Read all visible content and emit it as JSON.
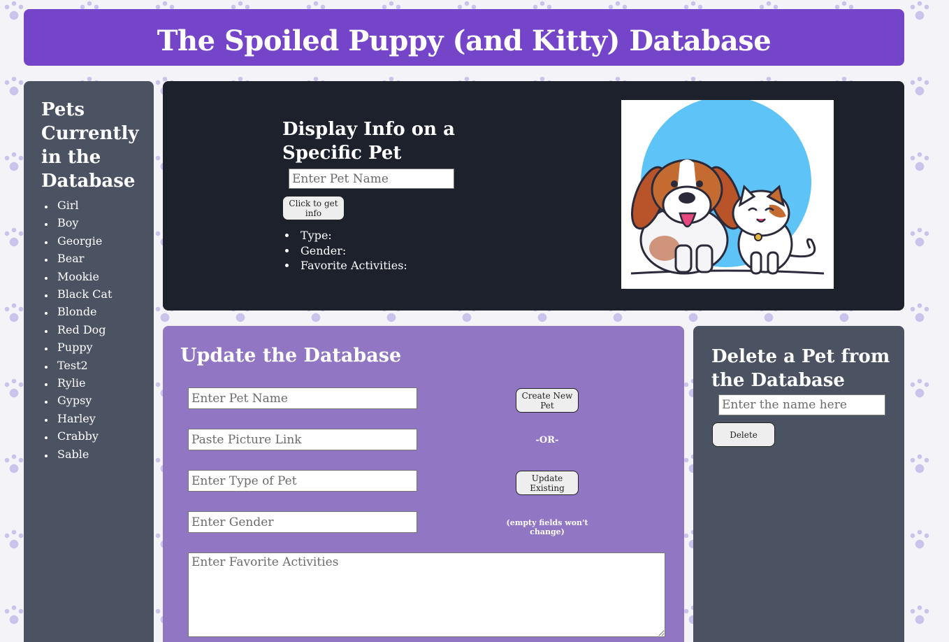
{
  "header": {
    "title": "The Spoiled Puppy (and Kitty) Database"
  },
  "sidebar": {
    "title": "Pets Currently in the Database",
    "pets": [
      "Girl",
      "Boy",
      "Georgie",
      "Bear",
      "Mookie",
      "Black Cat",
      "Blonde",
      "Red Dog",
      "Puppy",
      "Test2",
      "Rylie",
      "Gypsy",
      "Harley",
      "Crabby",
      "Sable"
    ]
  },
  "display": {
    "title": "Display Info on a Specific Pet",
    "pet_name_placeholder": "Enter Pet Name",
    "get_info_label": "Click to get info",
    "type_label": "Type:",
    "gender_label": "Gender:",
    "activities_label": "Favorite Activities:",
    "image_icon": "puppy-and-kitty-illustration"
  },
  "update": {
    "title": "Update the Database",
    "pet_name_placeholder": "Enter Pet Name",
    "picture_placeholder": "Paste Picture Link",
    "type_placeholder": "Enter Type of Pet",
    "gender_placeholder": "Enter Gender",
    "activities_placeholder": "Enter Favorite Activities",
    "create_label": "Create New Pet",
    "or_label": "-OR-",
    "update_label": "Update Existing",
    "note": "(empty fields won't change)"
  },
  "delete": {
    "title": "Delete a Pet from the Database",
    "name_placeholder": "Enter the name here",
    "delete_label": "Delete"
  },
  "colors": {
    "header": "#7545c9",
    "sidebar": "#4b5363",
    "display_panel": "#1c212c",
    "update_panel": "#9176c3",
    "delete_panel": "#4b5363"
  }
}
